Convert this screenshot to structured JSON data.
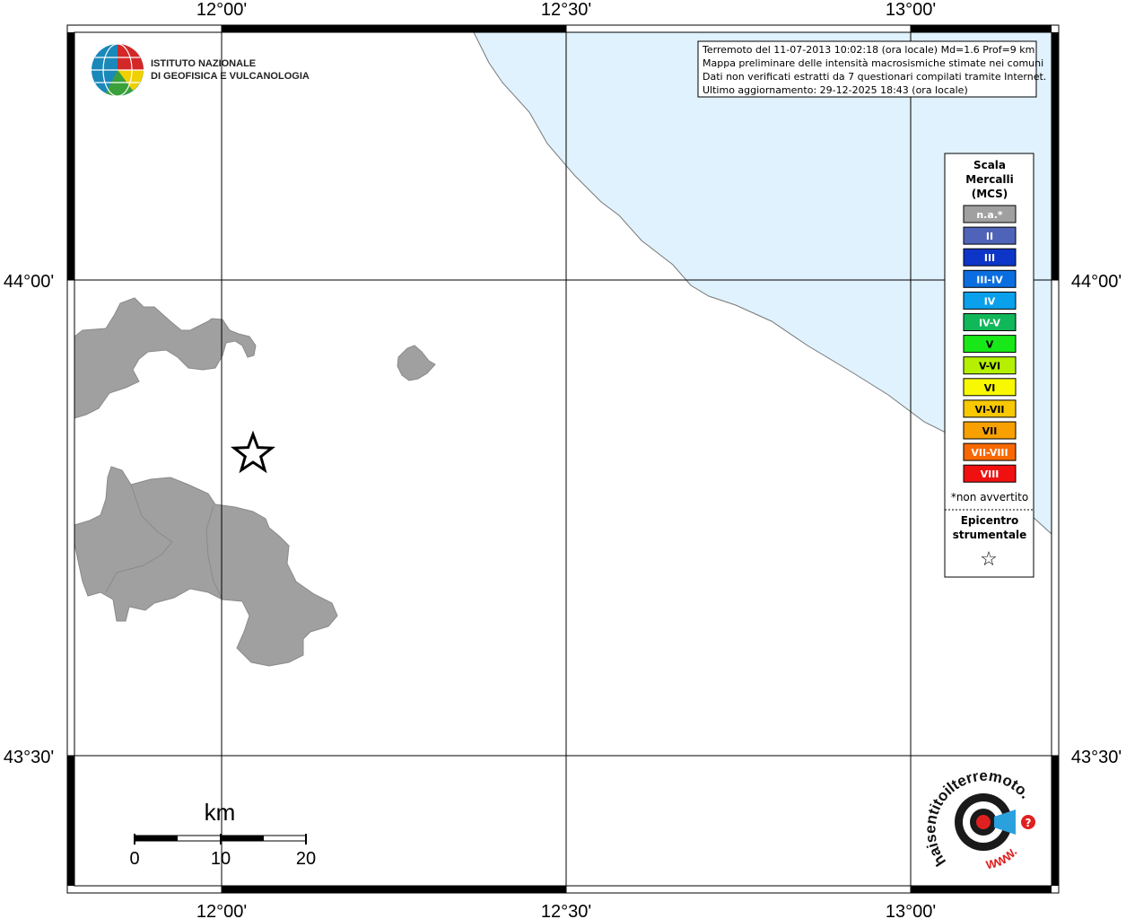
{
  "axes": {
    "top_labels": [
      "12°00'",
      "12°30'",
      "13°00'"
    ],
    "bottom_labels": [
      "12°00'",
      "12°30'",
      "13°00'"
    ],
    "left_labels": [
      "44°00'",
      "43°30'"
    ],
    "right_labels": [
      "44°00'",
      "43°30'"
    ]
  },
  "info_box": {
    "lines": [
      "Terremoto del 11-07-2013 10:02:18 (ora locale) Md=1.6 Prof=9 km",
      "Mappa preliminare delle intensità macrosismiche stimate nei comuni",
      "Dati non verificati estratti da 7 questionari compilati tramite Internet.",
      "Ultimo aggiornamento: 29-12-2025 18:43 (ora locale)"
    ]
  },
  "ingv_logo": {
    "line1": "ISTITUTO NAZIONALE",
    "line2": "DI GEOFISICA E VULCANOLOGIA"
  },
  "legend": {
    "title_lines": [
      "Scala",
      "Mercalli",
      "(MCS)"
    ],
    "items": [
      {
        "label": "n.a.*",
        "color": "#a0a0a0",
        "dark": false
      },
      {
        "label": "II",
        "color": "#4f64b8",
        "dark": false
      },
      {
        "label": "III",
        "color": "#0d36c8",
        "dark": false
      },
      {
        "label": "III-IV",
        "color": "#0a6ee0",
        "dark": false
      },
      {
        "label": "IV",
        "color": "#0aa0ec",
        "dark": false
      },
      {
        "label": "IV-V",
        "color": "#10b85a",
        "dark": false
      },
      {
        "label": "V",
        "color": "#18e818",
        "dark": true
      },
      {
        "label": "V-VI",
        "color": "#b4f000",
        "dark": true
      },
      {
        "label": "VI",
        "color": "#f8f800",
        "dark": true
      },
      {
        "label": "VI-VII",
        "color": "#f8c800",
        "dark": true
      },
      {
        "label": "VII",
        "color": "#f8a000",
        "dark": true
      },
      {
        "label": "VII-VIII",
        "color": "#f86800",
        "dark": false
      },
      {
        "label": "VIII",
        "color": "#f01010",
        "dark": false
      }
    ],
    "note": "*non avvertito",
    "epicenter_lines": [
      "Epicentro",
      "strumentale"
    ],
    "epicenter_symbol": "☆"
  },
  "scale_bar": {
    "unit": "km",
    "labels": [
      "0",
      "10",
      "20"
    ]
  },
  "hsit_logo": {
    "text": "haisentitoilterremoto.it",
    "www": "WWW.",
    "question": "?"
  },
  "colors": {
    "sea": "#dff2fd",
    "land_comune": "#a0a0a0",
    "grid": "#000000"
  }
}
